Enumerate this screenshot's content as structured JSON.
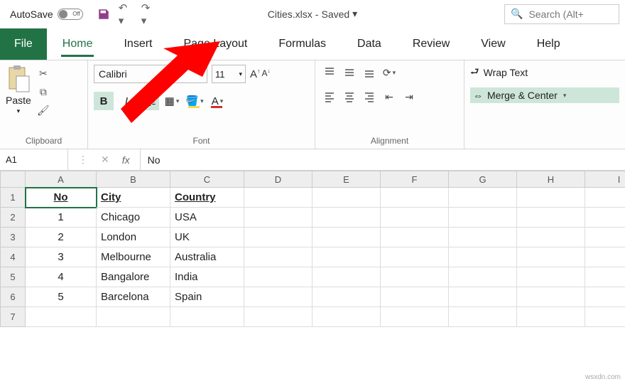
{
  "titlebar": {
    "autosave_label": "AutoSave",
    "toggle_state": "Off",
    "doc_name": "Cities.xlsx",
    "doc_state": "Saved",
    "search_placeholder": "Search (Alt+"
  },
  "tabs": {
    "file": "File",
    "home": "Home",
    "insert": "Insert",
    "page_layout": "Page Layout",
    "formulas": "Formulas",
    "data": "Data",
    "review": "Review",
    "view": "View",
    "help": "Help"
  },
  "ribbon": {
    "clipboard": {
      "paste": "Paste",
      "label": "Clipboard"
    },
    "font": {
      "name": "Calibri",
      "size": "11",
      "bold": "B",
      "italic": "I",
      "underline": "U",
      "label": "Font"
    },
    "alignment": {
      "wrap": "Wrap Text",
      "merge": "Merge & Center",
      "label": "Alignment"
    }
  },
  "formula_bar": {
    "cell_ref": "A1",
    "value": "No"
  },
  "columns": [
    "A",
    "B",
    "C",
    "D",
    "E",
    "F",
    "G",
    "H",
    "I"
  ],
  "rows": [
    "1",
    "2",
    "3",
    "4",
    "5",
    "6",
    "7"
  ],
  "headers": {
    "a": "No",
    "b": "City",
    "c": "Country"
  },
  "data_rows": [
    {
      "no": "1",
      "city": "Chicago",
      "country": "USA"
    },
    {
      "no": "2",
      "city": "London",
      "country": "UK"
    },
    {
      "no": "3",
      "city": "Melbourne",
      "country": "Australia"
    },
    {
      "no": "4",
      "city": "Bangalore",
      "country": "India"
    },
    {
      "no": "5",
      "city": "Barcelona",
      "country": "Spain"
    }
  ],
  "watermark": "wsxdn.com"
}
